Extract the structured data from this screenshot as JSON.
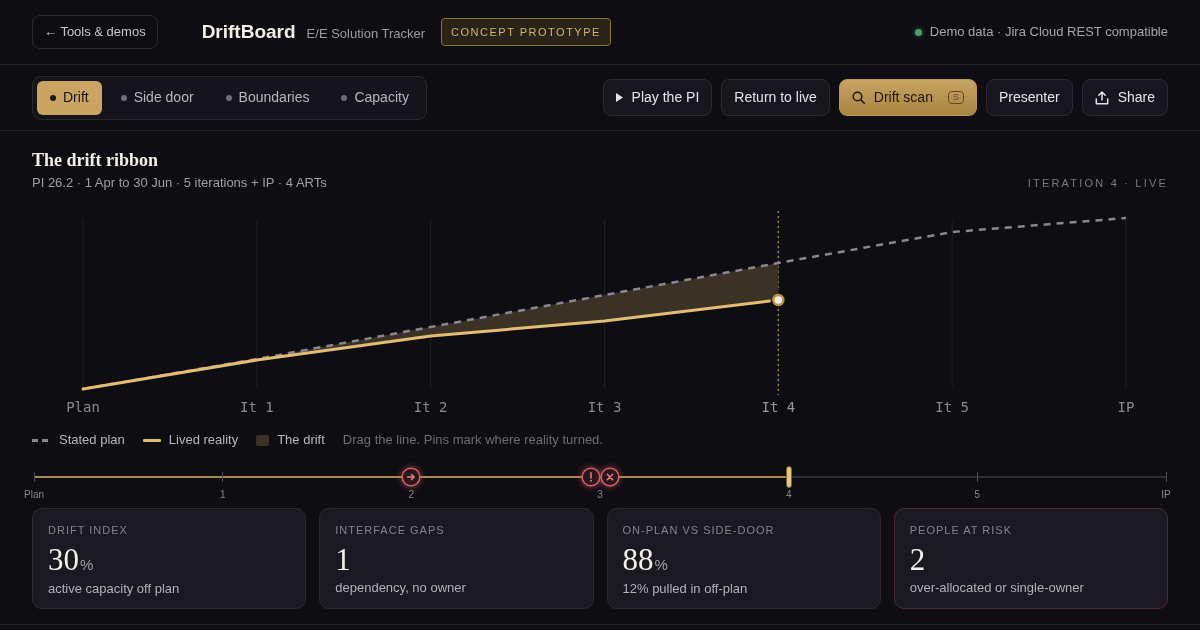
{
  "header": {
    "back_link": "← Tools & demos",
    "app_name": "DriftBoard",
    "app_subtitle": "E/E Solution Tracker",
    "badge": "CONCEPT PROTOTYPE",
    "data_source": "Demo data · Jira Cloud REST compatible"
  },
  "tabs": [
    {
      "label": "Drift",
      "selected": true
    },
    {
      "label": "Side door",
      "selected": false
    },
    {
      "label": "Boundaries",
      "selected": false
    },
    {
      "label": "Capacity",
      "selected": false
    }
  ],
  "actions": [
    {
      "label": "Play the PI",
      "kind": "default"
    },
    {
      "label": "Return to live",
      "kind": "default"
    },
    {
      "label": "Drift scan",
      "kind": "primary",
      "shortcut": "S"
    },
    {
      "label": "Presenter",
      "kind": "default"
    },
    {
      "label": "Share",
      "kind": "default"
    }
  ],
  "ribbon": {
    "title": "The drift ribbon",
    "subtitle": "PI 26.2 · 1 Apr to 30 Jun · 5 iterations + IP · 4 ARTs",
    "status": "ITERATION 4 · LIVE",
    "axis_labels": [
      {
        "label": "Plan",
        "selected": false
      },
      {
        "label": "It 1",
        "selected": false
      },
      {
        "label": "It 2",
        "selected": false
      },
      {
        "label": "It 3",
        "selected": false
      },
      {
        "label": "It 4",
        "selected": true
      },
      {
        "label": "It 5",
        "selected": false
      },
      {
        "label": "IP",
        "selected": false
      }
    ],
    "legend": [
      {
        "kind": "plan",
        "label": "Stated plan"
      },
      {
        "kind": "lived",
        "label": "Lived reality"
      },
      {
        "kind": "drift",
        "label": "The drift"
      }
    ],
    "hint": "Drag the line. Pins mark where reality turned."
  },
  "timeline": {
    "level": 0.6667,
    "ticks": [
      {
        "label": "Plan"
      },
      {
        "label": "1"
      },
      {
        "label": "2",
        "pins": [
          {
            "kind": "arrow"
          }
        ]
      },
      {
        "label": "3",
        "pins": [
          {
            "kind": "alert"
          },
          {
            "kind": "cross"
          }
        ]
      },
      {
        "label": "4"
      },
      {
        "label": "5"
      },
      {
        "label": "IP"
      }
    ]
  },
  "metrics": [
    {
      "label": "DRIFT INDEX",
      "value": "30",
      "unit": "%",
      "caption": "active capacity off plan",
      "alert": false
    },
    {
      "label": "INTERFACE GAPS",
      "value": "1",
      "caption": "dependency, no owner",
      "alert": false
    },
    {
      "label": "ON-PLAN VS SIDE-DOOR",
      "value": "88",
      "unit": "%",
      "caption": "12% pulled in off-plan",
      "alert": false
    },
    {
      "label": "PEOPLE AT RISK",
      "value": "2",
      "caption": "over-allocated or single-owner",
      "alert": true
    }
  ]
}
